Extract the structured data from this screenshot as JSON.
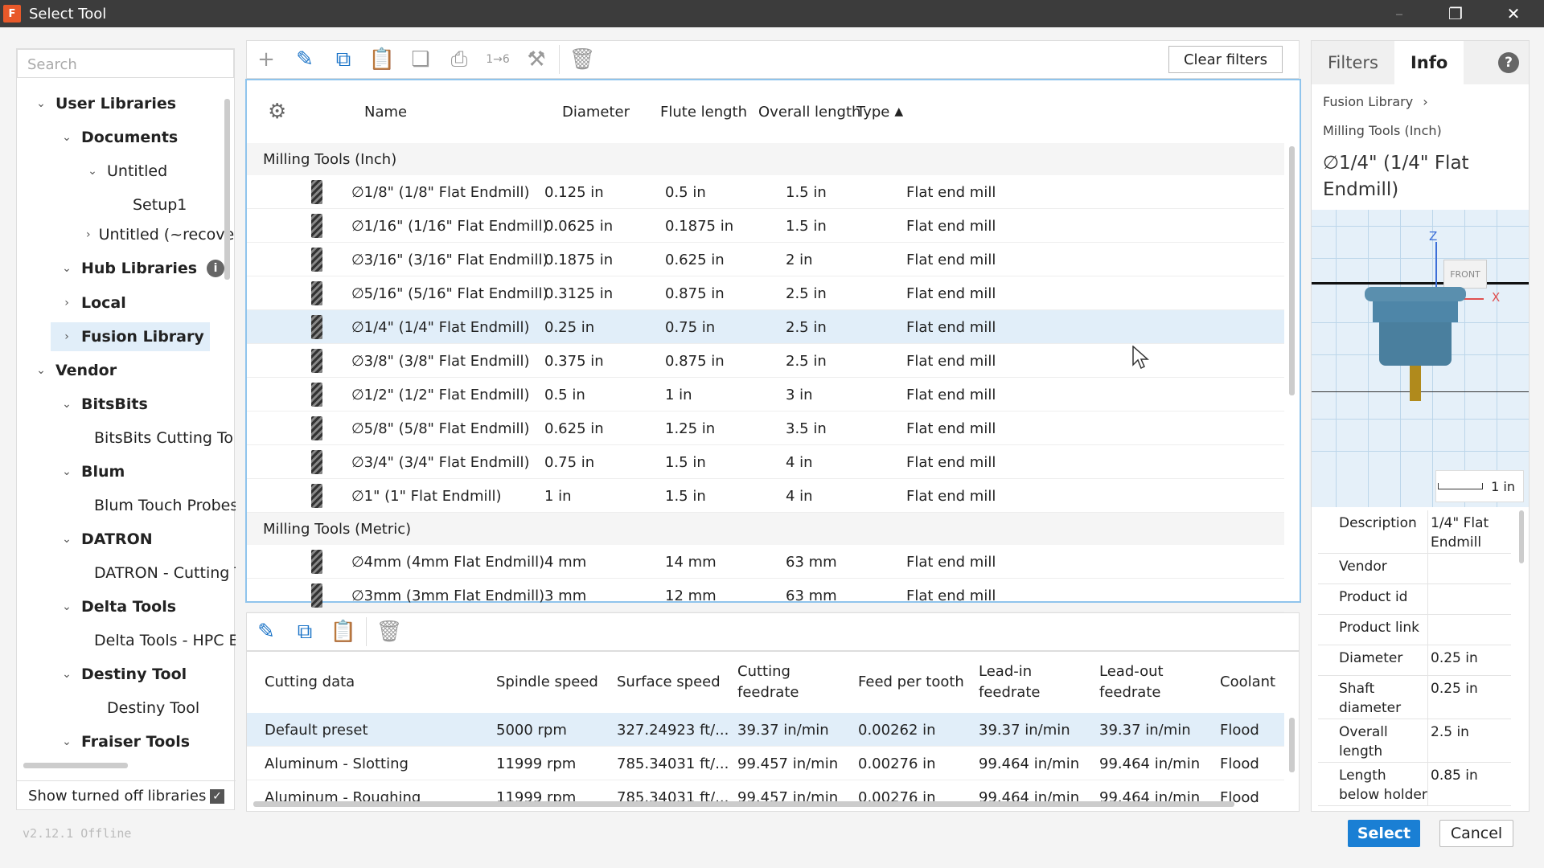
{
  "window": {
    "title": "Select Tool",
    "icon_letter": "F"
  },
  "left": {
    "search_placeholder": "Search",
    "tree": [
      {
        "label": "User Libraries",
        "level": 0,
        "chev": "⌄"
      },
      {
        "label": "Documents",
        "level": 1,
        "chev": "⌄"
      },
      {
        "label": "Untitled",
        "level": 2,
        "chev": "⌄"
      },
      {
        "label": "Setup1",
        "level": 3,
        "chev": ""
      },
      {
        "label": "Untitled (~recove",
        "level": 2,
        "chev": "›"
      },
      {
        "label": "Hub Libraries",
        "level": 1,
        "chev": "⌄",
        "info": true
      },
      {
        "label": "Local",
        "level": 1,
        "chev": "›"
      },
      {
        "label": "Fusion Library",
        "level": 1,
        "chev": "›",
        "selected": true
      },
      {
        "label": "Vendor",
        "level": 0,
        "chev": "⌄"
      },
      {
        "label": "BitsBits",
        "level": 1,
        "chev": "⌄"
      },
      {
        "label": "BitsBits Cutting To",
        "level": 2,
        "chev": ""
      },
      {
        "label": "Blum",
        "level": 1,
        "chev": "⌄"
      },
      {
        "label": "Blum Touch Probes",
        "level": 2,
        "chev": ""
      },
      {
        "label": "DATRON",
        "level": 1,
        "chev": "⌄"
      },
      {
        "label": "DATRON - Cutting T",
        "level": 2,
        "chev": ""
      },
      {
        "label": "Delta Tools",
        "level": 1,
        "chev": "⌄"
      },
      {
        "label": "Delta Tools - HPC E",
        "level": 2,
        "chev": ""
      },
      {
        "label": "Destiny Tool",
        "level": 1,
        "chev": "⌄"
      },
      {
        "label": "Destiny Tool",
        "level": 2,
        "chev": ""
      },
      {
        "label": "Fraiser Tools",
        "level": 1,
        "chev": "⌄"
      }
    ],
    "show_off_label": "Show turned off libraries",
    "show_off_checked": true,
    "version": "v2.12.1 Offline"
  },
  "toolbar": {
    "clear_filters": "Clear filters"
  },
  "tools_table": {
    "headers": {
      "name": "Name",
      "diameter": "Diameter",
      "flute": "Flute length",
      "overall": "Overall length",
      "type": "Type"
    },
    "groups": [
      {
        "label": "Milling Tools (Inch)",
        "rows": [
          {
            "name": "∅1/8\" (1/8\" Flat Endmill)",
            "diameter": "0.125 in",
            "flute": "0.5 in",
            "overall": "1.5 in",
            "type": "Flat end mill"
          },
          {
            "name": "∅1/16\" (1/16\" Flat Endmill)",
            "diameter": "0.0625 in",
            "flute": "0.1875 in",
            "overall": "1.5 in",
            "type": "Flat end mill"
          },
          {
            "name": "∅3/16\" (3/16\" Flat Endmill)",
            "diameter": "0.1875 in",
            "flute": "0.625 in",
            "overall": "2 in",
            "type": "Flat end mill"
          },
          {
            "name": "∅5/16\" (5/16\" Flat Endmill)",
            "diameter": "0.3125 in",
            "flute": "0.875 in",
            "overall": "2.5 in",
            "type": "Flat end mill"
          },
          {
            "name": "∅1/4\" (1/4\" Flat Endmill)",
            "diameter": "0.25 in",
            "flute": "0.75 in",
            "overall": "2.5 in",
            "type": "Flat end mill",
            "selected": true
          },
          {
            "name": "∅3/8\" (3/8\" Flat Endmill)",
            "diameter": "0.375 in",
            "flute": "0.875 in",
            "overall": "2.5 in",
            "type": "Flat end mill"
          },
          {
            "name": "∅1/2\" (1/2\" Flat Endmill)",
            "diameter": "0.5 in",
            "flute": "1 in",
            "overall": "3 in",
            "type": "Flat end mill"
          },
          {
            "name": "∅5/8\" (5/8\" Flat Endmill)",
            "diameter": "0.625 in",
            "flute": "1.25 in",
            "overall": "3.5 in",
            "type": "Flat end mill"
          },
          {
            "name": "∅3/4\" (3/4\" Flat Endmill)",
            "diameter": "0.75 in",
            "flute": "1.5 in",
            "overall": "4 in",
            "type": "Flat end mill"
          },
          {
            "name": "∅1\" (1\" Flat Endmill)",
            "diameter": "1 in",
            "flute": "1.5 in",
            "overall": "4 in",
            "type": "Flat end mill"
          }
        ]
      },
      {
        "label": "Milling Tools (Metric)",
        "rows": [
          {
            "name": "∅4mm (4mm Flat Endmill)",
            "diameter": "4 mm",
            "flute": "14 mm",
            "overall": "63 mm",
            "type": "Flat end mill"
          },
          {
            "name": "∅3mm (3mm Flat Endmill)",
            "diameter": "3 mm",
            "flute": "12 mm",
            "overall": "63 mm",
            "type": "Flat end mill"
          }
        ]
      }
    ]
  },
  "presets": {
    "headers": [
      {
        "key": "cutting",
        "label": "Cutting data"
      },
      {
        "key": "spindle",
        "label": "Spindle speed"
      },
      {
        "key": "surface",
        "label": "Surface speed"
      },
      {
        "key": "feed",
        "label": "Cutting feedrate"
      },
      {
        "key": "fpt",
        "label": "Feed per tooth"
      },
      {
        "key": "leadin",
        "label": "Lead-in feedrate"
      },
      {
        "key": "leadout",
        "label": "Lead-out feedrate"
      },
      {
        "key": "coolant",
        "label": "Coolant"
      }
    ],
    "rows": [
      {
        "cutting": "Default preset",
        "spindle": "5000 rpm",
        "surface": "327.24923 ft/...",
        "feed": "39.37 in/min",
        "fpt": "0.00262 in",
        "leadin": "39.37 in/min",
        "leadout": "39.37 in/min",
        "coolant": "Flood",
        "selected": true
      },
      {
        "cutting": "Aluminum - Slotting",
        "spindle": "11999 rpm",
        "surface": "785.34031 ft/...",
        "feed": "99.457 in/min",
        "fpt": "0.00276 in",
        "leadin": "99.464 in/min",
        "leadout": "99.464 in/min",
        "coolant": "Flood"
      },
      {
        "cutting": "Aluminum - Roughing",
        "spindle": "11999 rpm",
        "surface": "785.34031 ft/...",
        "feed": "99.457 in/min",
        "fpt": "0.00276 in",
        "leadin": "99.464 in/min",
        "leadout": "99.464 in/min",
        "coolant": "Flood"
      }
    ]
  },
  "right": {
    "tabs": [
      "Filters",
      "Info"
    ],
    "active_tab": "Info",
    "crumb1": "Fusion Library",
    "crumb2": "Milling Tools (Inch)",
    "title": "∅1/4\" (1/4\" Flat Endmill)",
    "preview": {
      "z_label": "Z",
      "front_label": "FRONT",
      "x_label": "X",
      "scale": "1 in"
    },
    "properties": [
      {
        "key": "Description",
        "value": "1/4\" Flat Endmill"
      },
      {
        "key": "Vendor",
        "value": ""
      },
      {
        "key": "Product id",
        "value": ""
      },
      {
        "key": "Product link",
        "value": ""
      },
      {
        "key": "Diameter",
        "value": "0.25 in"
      },
      {
        "key": "Shaft diameter",
        "value": "0.25 in"
      },
      {
        "key": "Overall length",
        "value": "2.5 in"
      },
      {
        "key": "Length below holder",
        "value": "0.85 in"
      }
    ]
  },
  "buttons": {
    "select": "Select",
    "cancel": "Cancel"
  }
}
